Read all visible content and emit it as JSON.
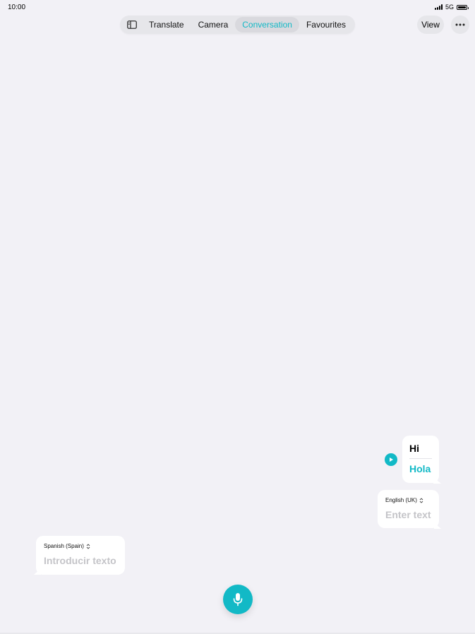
{
  "status": {
    "time": "10:00",
    "network": "5G"
  },
  "toolbar": {
    "tabs": [
      {
        "label": "Translate"
      },
      {
        "label": "Camera"
      },
      {
        "label": "Conversation"
      },
      {
        "label": "Favourites"
      }
    ],
    "active_tab": "Conversation",
    "view_label": "View"
  },
  "conversation": {
    "message": {
      "source": "Hi",
      "translation": "Hola"
    }
  },
  "right_input": {
    "language": "English (UK)",
    "placeholder": "Enter text"
  },
  "left_input": {
    "language": "Spanish (Spain)",
    "placeholder": "Introducir texto"
  },
  "colors": {
    "accent": "#12b9c6",
    "background": "#f2f1f6"
  },
  "icons": [
    "sidebar-icon",
    "more-icon",
    "play-icon",
    "chevron-updown-icon",
    "microphone-icon"
  ]
}
